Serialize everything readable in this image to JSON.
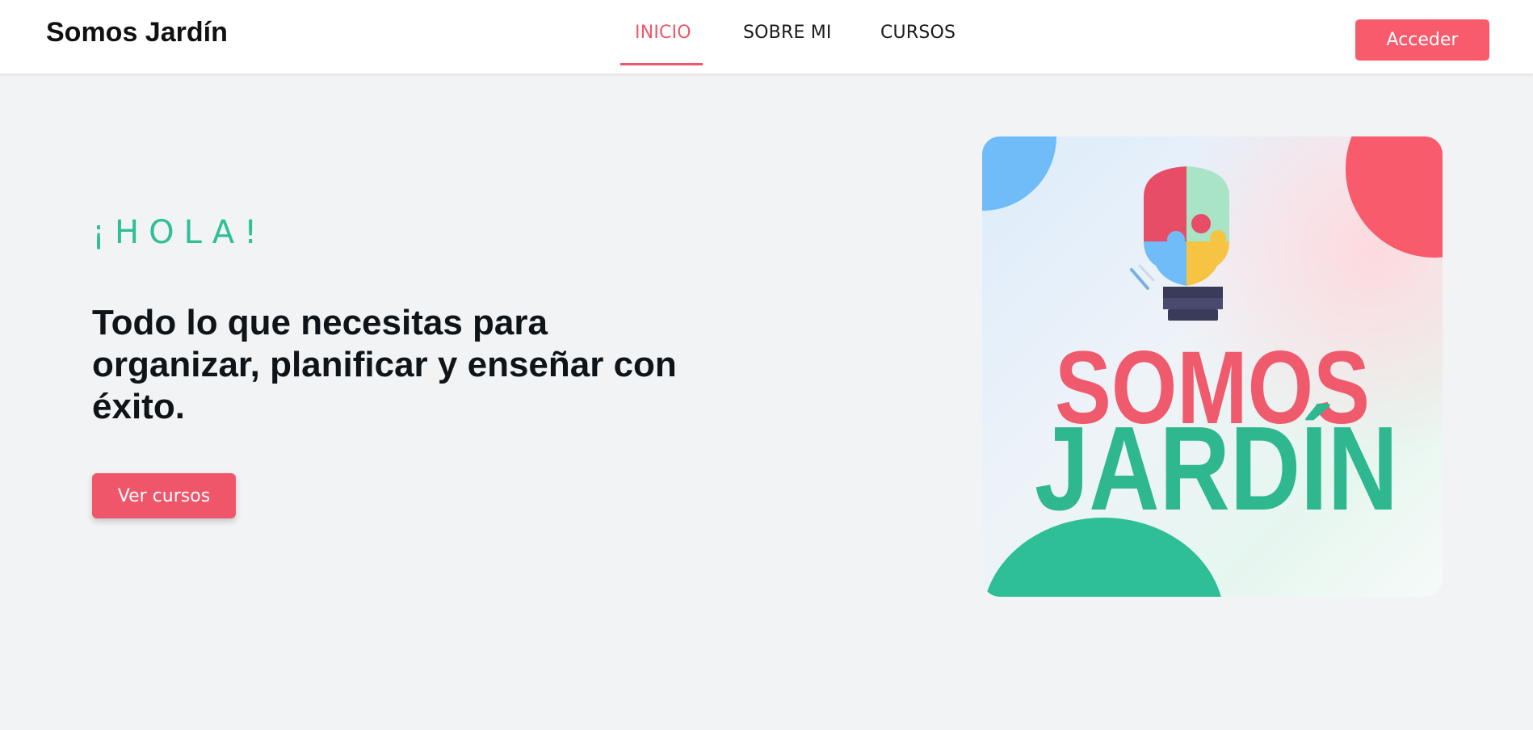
{
  "navbar": {
    "brand": "Somos Jardín",
    "links": [
      {
        "label": "INICIO",
        "active": true
      },
      {
        "label": "SOBRE MI",
        "active": false
      },
      {
        "label": "CURSOS",
        "active": false
      }
    ],
    "login_label": "Acceder"
  },
  "hero": {
    "greeting": "¡HOLA!",
    "title": "Todo lo que necesitas para organizar, planificar y enseñar con éxito.",
    "cta_label": "Ver cursos",
    "image": {
      "logo_text_top": "SOMOS",
      "logo_text_bottom": "JARDÍN",
      "icon": "lightbulb-puzzle-icon"
    }
  },
  "colors": {
    "accent": "#f0566a",
    "green": "#2fbf97",
    "background": "#f2f3f5",
    "text": "#0f1418"
  }
}
